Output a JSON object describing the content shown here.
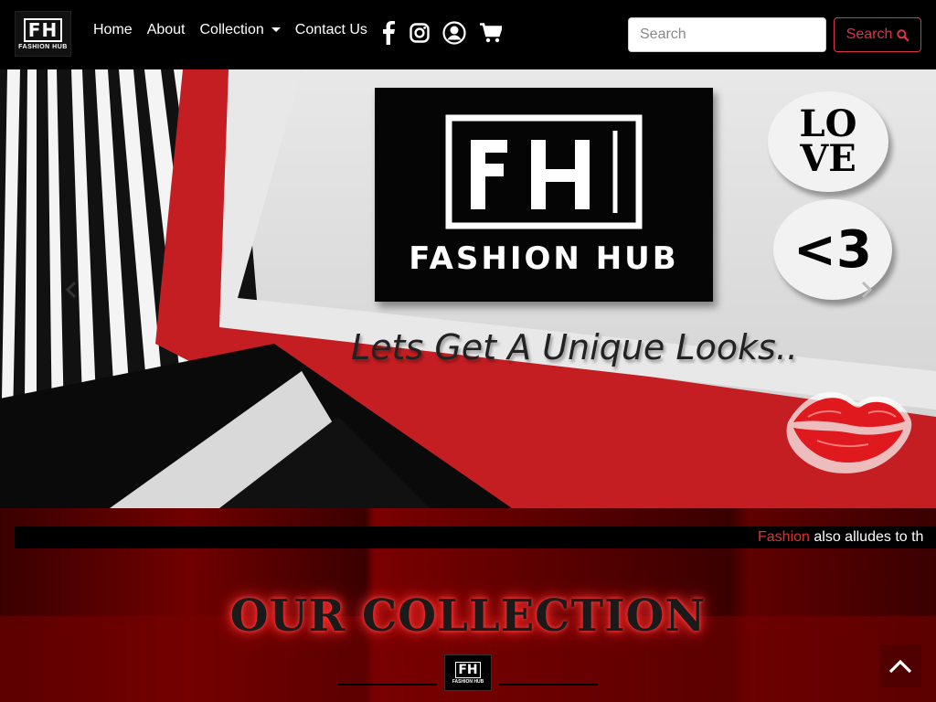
{
  "brand": {
    "logo_text": "FH",
    "logo_sub": "FASHION HUB"
  },
  "nav": {
    "home": "Home",
    "about": "About",
    "collection": "Collection",
    "contact": "Contact Us"
  },
  "icons": [
    "facebook-icon",
    "instagram-icon",
    "user-icon",
    "cart-icon",
    "search-icon",
    "chevron-up-icon"
  ],
  "search": {
    "placeholder": "Search",
    "button_label": "Search"
  },
  "hero": {
    "logo_text": "FH",
    "logo_sub": "FASHION HUB",
    "tagline": "Lets Get A Unique Looks..",
    "bubble_love": "LO VE",
    "bubble_heart": "<3"
  },
  "ticker": {
    "highlight": "Fashion",
    "rest": " also alludes to th"
  },
  "section": {
    "title": "OUR COLLECTION",
    "mini_logo_text": "FH",
    "mini_logo_sub": "FASHION HUB"
  },
  "colors": {
    "accent": "#dc3545",
    "nav_bg": "#000000",
    "section_bg": "#5a0000"
  }
}
